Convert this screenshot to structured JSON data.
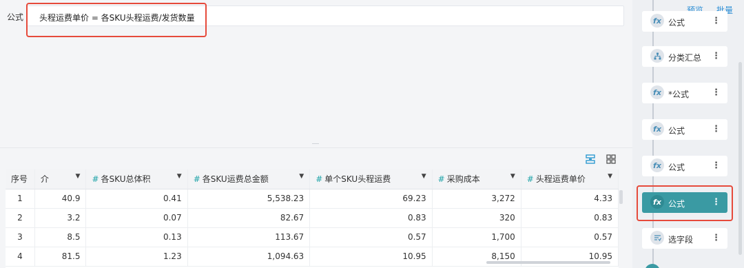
{
  "formula": {
    "label": "公式",
    "expression": "头程运费单价 = 各SKU头程运费/发货数量"
  },
  "toolbar": {
    "view_list_icon": "list-view-icon",
    "view_grid_icon": "grid-view-icon"
  },
  "table": {
    "columns": [
      {
        "label": "序号",
        "hash": "",
        "dropdown": false
      },
      {
        "label": "介",
        "hash": "",
        "dropdown": true
      },
      {
        "label": "各SKU总体积",
        "hash": "#",
        "dropdown": true
      },
      {
        "label": "各SKU运费总金额",
        "hash": "#",
        "dropdown": true
      },
      {
        "label": "单个SKU头程运费",
        "hash": "#",
        "dropdown": true
      },
      {
        "label": "采购成本",
        "hash": "#",
        "dropdown": true
      },
      {
        "label": "头程运费单价",
        "hash": "#",
        "dropdown": true
      }
    ],
    "rows": [
      [
        "1",
        "40.9",
        "0.41",
        "5,538.23",
        "69.23",
        "3,272",
        "4.33"
      ],
      [
        "2",
        "3.2",
        "0.07",
        "82.67",
        "0.83",
        "320",
        "0.83"
      ],
      [
        "3",
        "8.5",
        "0.13",
        "113.67",
        "0.57",
        "1,700",
        "0.57"
      ],
      [
        "4",
        "81.5",
        "1.23",
        "1,094.63",
        "10.95",
        "8,150",
        "10.95"
      ]
    ]
  },
  "pipeline": {
    "preview": "预览",
    "batch": "批量",
    "more": "⋮",
    "steps": [
      {
        "label": "公式",
        "icon": "fx",
        "active": false
      },
      {
        "label": "分类汇总",
        "icon": "group",
        "active": false
      },
      {
        "label": "*公式",
        "icon": "fx",
        "active": false
      },
      {
        "label": "公式",
        "icon": "fx",
        "active": false
      },
      {
        "label": "公式",
        "icon": "fx",
        "active": false
      },
      {
        "label": "公式",
        "icon": "fx",
        "active": true
      },
      {
        "label": "选字段",
        "icon": "select",
        "active": false
      }
    ]
  },
  "colors": {
    "accent": "#3a9aa3",
    "highlight": "#e64a3b",
    "link": "#2e8fd6",
    "hash": "#1fa3a8"
  }
}
